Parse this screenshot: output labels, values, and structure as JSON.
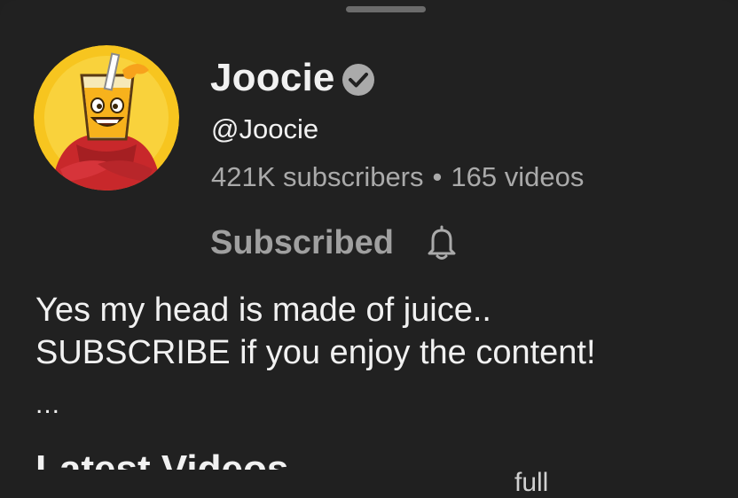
{
  "channel": {
    "name": "Joocie",
    "handle": "@Joocie",
    "subscribers": "421K subscribers",
    "separator": "•",
    "videos": "165 videos",
    "verified_icon": "verified-check-icon",
    "avatar_icon": "juice-cup-character-avatar"
  },
  "subscribe": {
    "label": "Subscribed",
    "bell_icon": "bell-icon"
  },
  "description": {
    "line1": "Yes my head is made of juice..",
    "line2": "SUBSCRIBE if you enjoy the content!",
    "more": "..."
  },
  "section": {
    "title": "Latest Videos"
  },
  "background": {
    "partial_text": "full"
  },
  "colors": {
    "background": "#212121",
    "text_primary": "#f1f1f1",
    "text_secondary": "#aaaaaa",
    "verified": "#aaaaaa"
  }
}
